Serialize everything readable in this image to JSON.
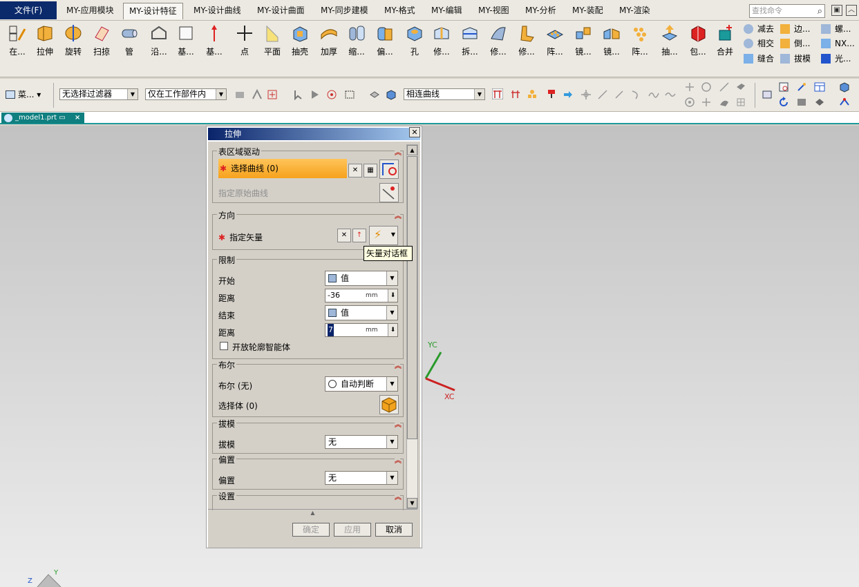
{
  "menubar": {
    "file_label": "文件(F)",
    "tabs": [
      "MY-应用模块",
      "MY-设计特征",
      "MY-设计曲线",
      "MY-设计曲面",
      "MY-同步建模",
      "MY-格式",
      "MY-编辑",
      "MY-视图",
      "MY-分析",
      "MY-装配",
      "MY-渲染"
    ],
    "active_tab": "MY-设计特征",
    "search_placeholder": "查找命令"
  },
  "ribbon": {
    "buttons": [
      "在...",
      "拉伸",
      "旋转",
      "扫掠",
      "管",
      "沿...",
      "基...",
      "基...",
      "点",
      "平面",
      "抽壳",
      "加厚",
      "缩...",
      "偏...",
      "孔",
      "修...",
      "拆...",
      "修...",
      "修...",
      "阵...",
      "镜...",
      "镜...",
      "阵...",
      "抽...",
      "包...",
      "合并"
    ],
    "small_col1": [
      "减去",
      "相交",
      "缝合"
    ],
    "small_col2": [
      "边...",
      "倒...",
      "拔模"
    ],
    "small_col3": [
      "螺...",
      "NX...",
      "光..."
    ]
  },
  "selbar": {
    "menu_label": "菜...",
    "filter": "无选择过滤器",
    "scope": "仅在工作部件内",
    "curve_rule": "相连曲线"
  },
  "file_tab": "_model1.prt",
  "dialog": {
    "title": "拉伸",
    "section_drive": "表区域驱动",
    "select_curve": "选择曲线 (0)",
    "origin_curve": "指定原始曲线",
    "section_direction": "方向",
    "specify_vector": "指定矢量",
    "tooltip": "矢量对话框",
    "section_limits": "限制",
    "start_label": "开始",
    "start_value": "值",
    "distance1_label": "距离",
    "distance1_value": "-36",
    "unit": "mm",
    "end_label": "结束",
    "end_value": "值",
    "distance2_label": "距离",
    "distance2_value": "7",
    "open_profile": "开放轮廓智能体",
    "section_boolean": "布尔",
    "boolean_label": "布尔 (无)",
    "boolean_value": "自动判断",
    "select_body": "选择体 (0)",
    "section_draft": "拔模",
    "draft_label": "拔模",
    "draft_value": "无",
    "section_offset": "偏置",
    "offset_label": "偏置",
    "offset_value": "无",
    "section_settings": "设置",
    "ok": "确定",
    "apply": "应用",
    "cancel": "取消"
  },
  "viewport": {
    "yc": "YC",
    "xc": "XC",
    "z": "Z",
    "y": "Y"
  },
  "colors": {
    "file_menu_bg": "#0b2a6b",
    "file_tab_bg": "#0f7f80",
    "select_highlight": "#f6a21c",
    "yc_axis": "#2a9a2a",
    "xc_axis": "#cc2222"
  }
}
